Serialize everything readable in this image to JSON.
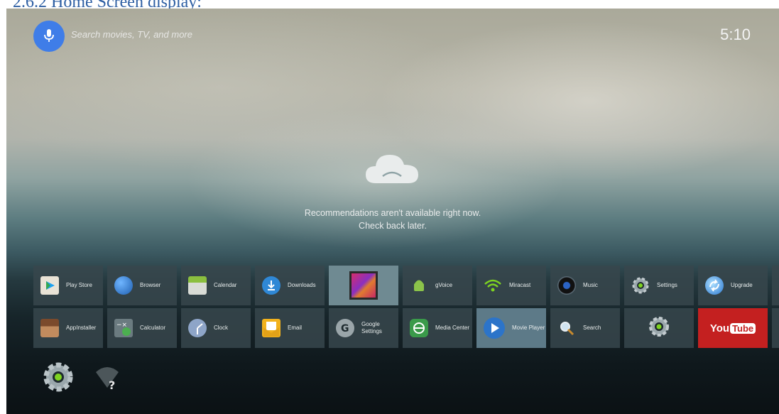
{
  "caption": "2.6.2 Home Screen display:",
  "search": {
    "placeholder": "Search movies, TV, and more",
    "icon": "mic-icon"
  },
  "clock": "5:10",
  "recommendations": {
    "line1": "Recommendations aren't available right now.",
    "line2": "Check back later."
  },
  "apps_row1": [
    {
      "label": "Play Store",
      "icon": "play-store-icon"
    },
    {
      "label": "Browser",
      "icon": "globe-icon"
    },
    {
      "label": "Calendar",
      "icon": "calendar-icon"
    },
    {
      "label": "Downloads",
      "icon": "download-icon"
    },
    {
      "label": "",
      "icon": "gallery-icon"
    },
    {
      "label": "gVoice",
      "icon": "android-icon"
    },
    {
      "label": "Miracast",
      "icon": "wifi-icon"
    },
    {
      "label": "Music",
      "icon": "speaker-icon"
    },
    {
      "label": "Settings",
      "icon": "gear-icon"
    },
    {
      "label": "Upgrade",
      "icon": "upgrade-icon"
    }
  ],
  "apps_row2": [
    {
      "label": "AppInstaller",
      "icon": "box-icon"
    },
    {
      "label": "Calculator",
      "icon": "calculator-icon"
    },
    {
      "label": "Clock",
      "icon": "clock-icon"
    },
    {
      "label": "Email",
      "icon": "email-icon"
    },
    {
      "label": "Google Settings",
      "icon": "google-icon"
    },
    {
      "label": "Media Center",
      "icon": "media-center-icon"
    },
    {
      "label": "Movie Player",
      "icon": "movie-player-icon"
    },
    {
      "label": "Search",
      "icon": "magnifier-icon"
    },
    {
      "label": "",
      "icon": "gear-icon"
    },
    {
      "label": "YouTube",
      "icon": "youtube-logo"
    }
  ],
  "youtube": {
    "you": "You",
    "tube": "Tube"
  },
  "colors": {
    "mic": "#3f7de8",
    "youtube": "#c42020",
    "tile": "#37464c"
  }
}
